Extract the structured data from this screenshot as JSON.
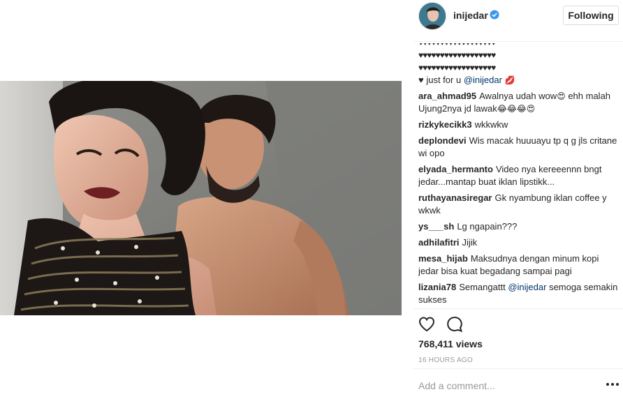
{
  "post": {
    "username": "inijedar",
    "follow_label": "Following"
  },
  "comments": {
    "caption_hearts_1": "♥♥♥♥♥♥♥♥♥♥♥♥♥♥♥♥♥♥",
    "caption_hearts_2": "♥♥♥♥♥♥♥♥♥♥♥♥♥♥♥♥♥♥",
    "caption_end_heart": "♥",
    "caption_text": "just for u",
    "caption_mention": "@inijedar",
    "caption_lips": "💋",
    "items": [
      {
        "user": "ara_ahmad95",
        "text": "Awalnya udah wow",
        "emoji1": "😍",
        "text2": " ehh malah Ujung2nya jd lawak",
        "emoji2": "😂😂😂😍"
      },
      {
        "user": "rizkykecikk3",
        "text": "wkkwkw"
      },
      {
        "user": "deplondevi",
        "text": "Wis macak huuuayu tp q g jls critane wi opo"
      },
      {
        "user": "elyada_hermanto",
        "text": "Video nya kereeennn bngt jedar...mantap buat iklan lipstikk..."
      },
      {
        "user": "ruthayanasiregar",
        "text": "Gk nyambung iklan coffee y wkwk"
      },
      {
        "user": "ys___sh",
        "text": "Lg ngapain???"
      },
      {
        "user": "adhilafitri",
        "text": "Jijik"
      },
      {
        "user": "mesa_hijab",
        "text": "Maksudnya dengan minum kopi jedar bisa kuat begadang sampai pagi"
      },
      {
        "user": "lizania78",
        "text": "Semangattt",
        "mention": "@inijedar",
        "text2": " semoga semakin sukses"
      }
    ]
  },
  "stats": {
    "views": "768,411 views",
    "timestamp": "16 HOURS AGO"
  },
  "composer": {
    "placeholder": "Add a comment..."
  },
  "colors": {
    "text": "#262626",
    "mention": "#003569",
    "muted": "#999999",
    "border": "#efefef",
    "verified": "#3897f0"
  }
}
